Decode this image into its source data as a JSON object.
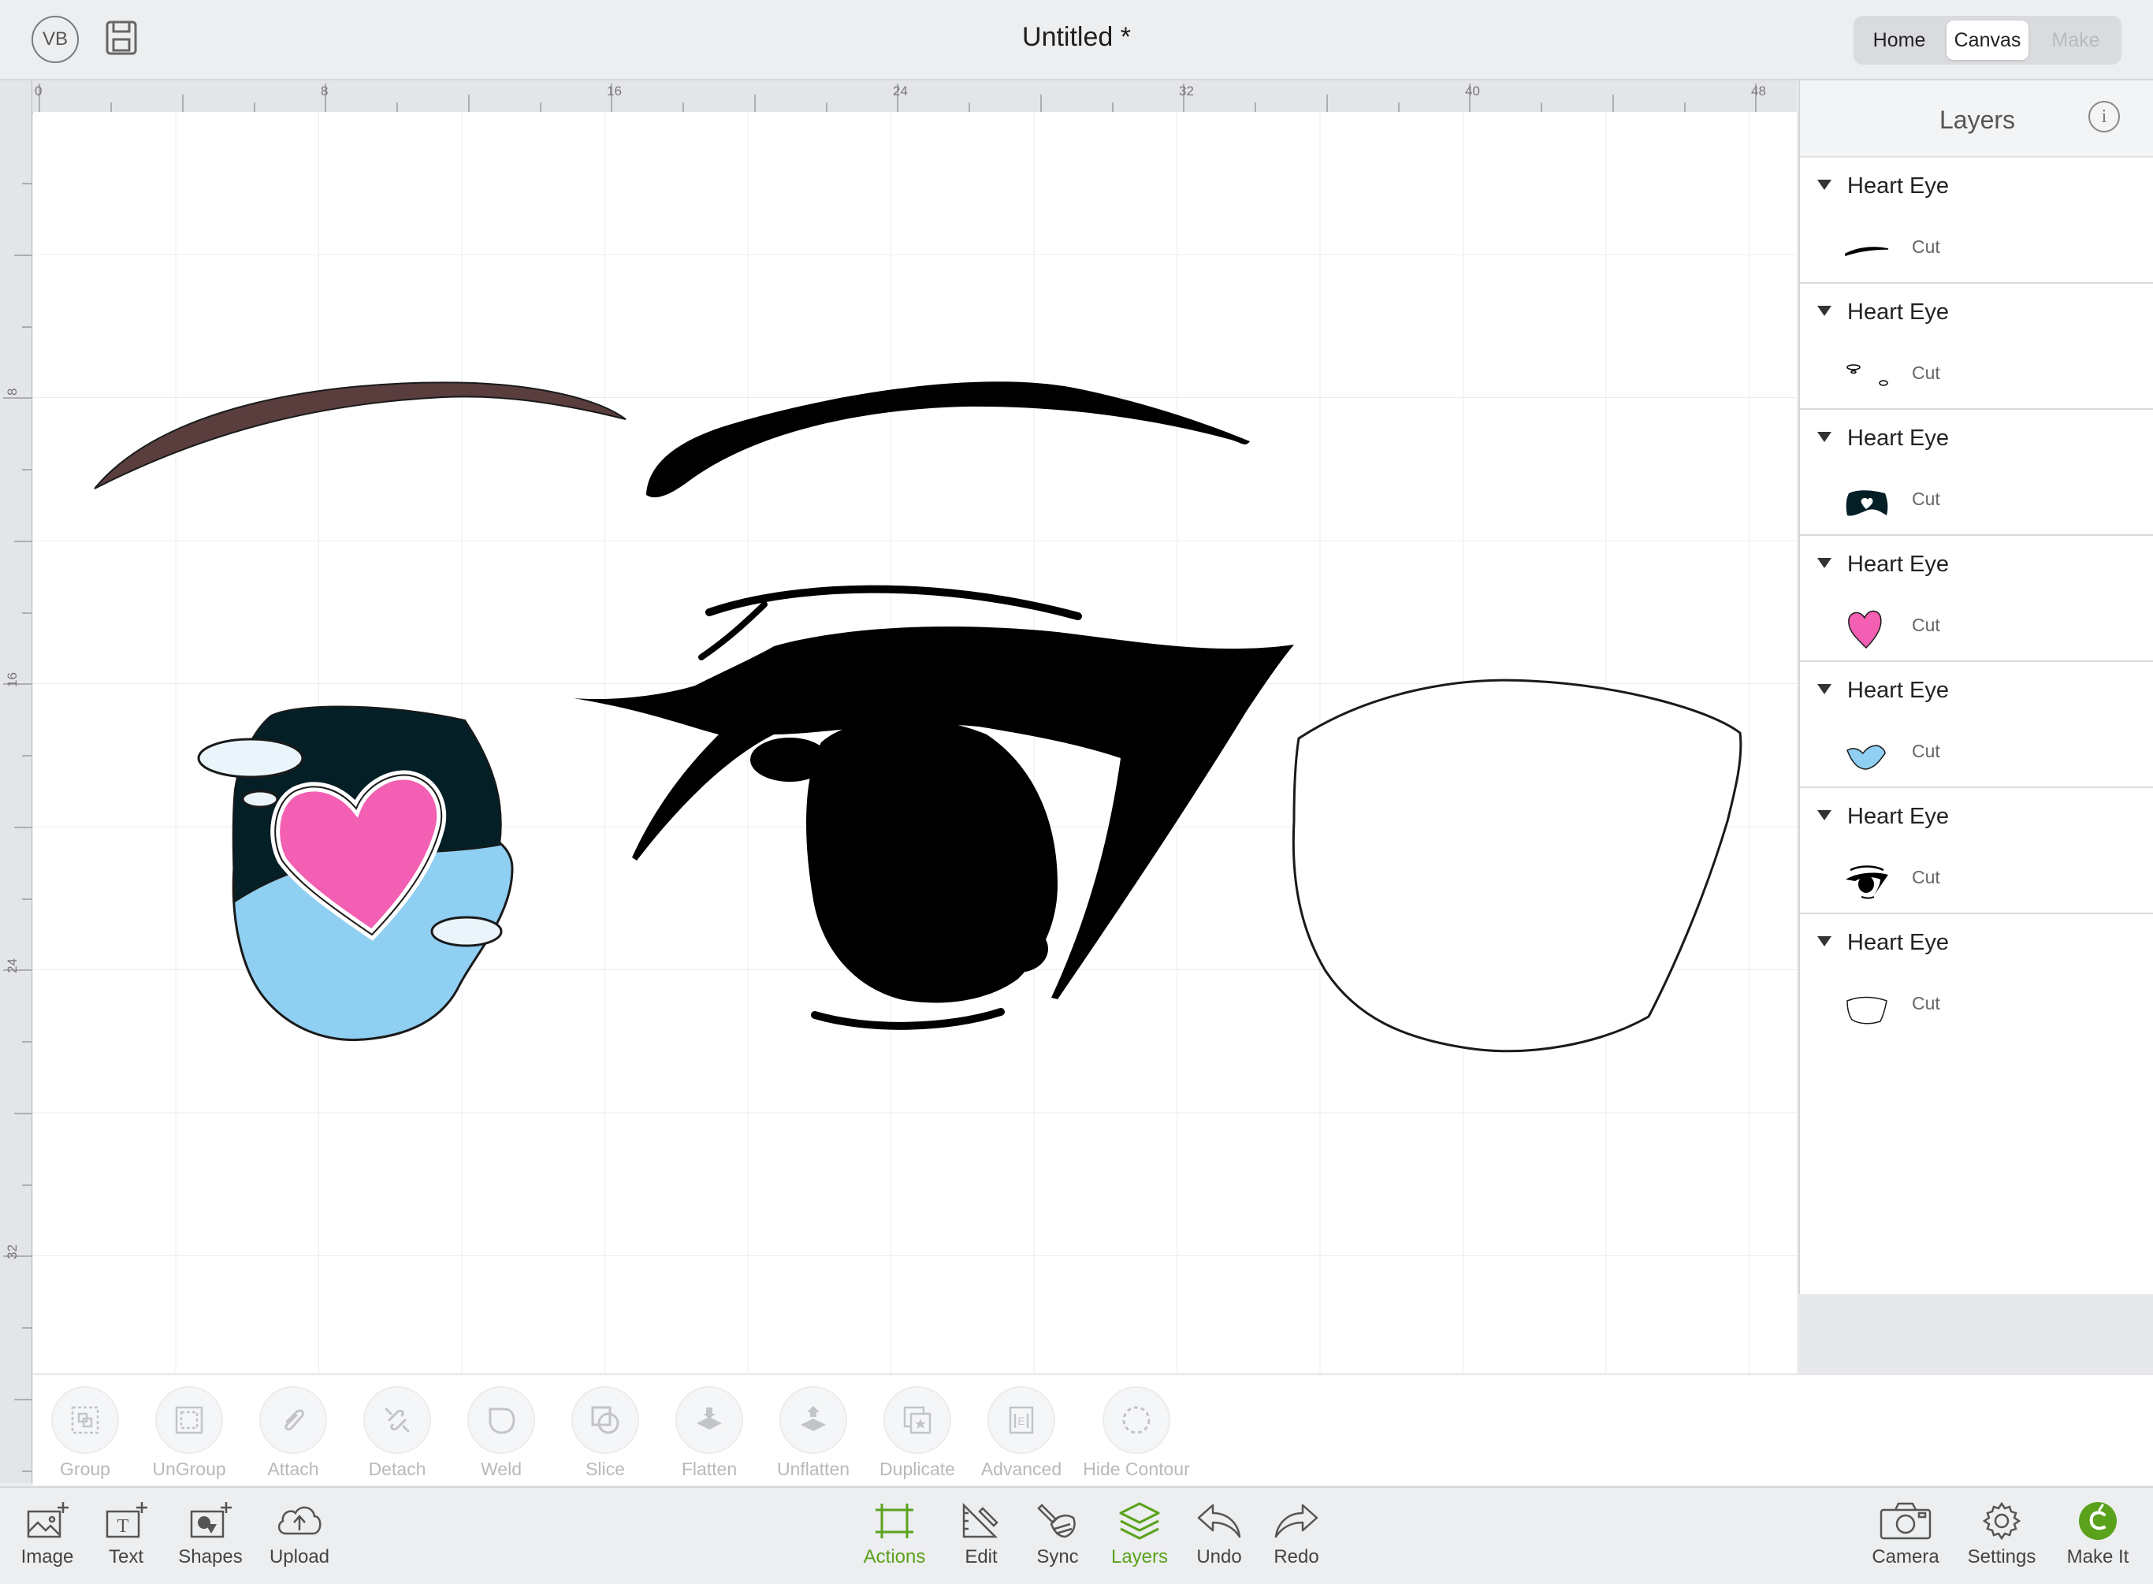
{
  "header": {
    "avatar_initials": "VB",
    "document_title": "Untitled *",
    "modes": {
      "home": "Home",
      "canvas": "Canvas",
      "make": "Make"
    },
    "active_mode": "Canvas"
  },
  "rulers": {
    "horizontal_labels": [
      "0",
      "8",
      "16",
      "24",
      "32",
      "40",
      "48"
    ],
    "vertical_labels": [
      "8",
      "16",
      "24",
      "32"
    ]
  },
  "layers_panel": {
    "title": "Layers",
    "items": [
      {
        "name": "Heart Eye",
        "operation": "Cut",
        "thumbnail": "eyebrow-left-thumb"
      },
      {
        "name": "Heart Eye",
        "operation": "Cut",
        "thumbnail": "highlights-thumb"
      },
      {
        "name": "Heart Eye",
        "operation": "Cut",
        "thumbnail": "iris-dark-thumb"
      },
      {
        "name": "Heart Eye",
        "operation": "Cut",
        "thumbnail": "heart-thumb"
      },
      {
        "name": "Heart Eye",
        "operation": "Cut",
        "thumbnail": "iris-light-thumb"
      },
      {
        "name": "Heart Eye",
        "operation": "Cut",
        "thumbnail": "eye-outline-thumb"
      },
      {
        "name": "Heart Eye",
        "operation": "Cut",
        "thumbnail": "eye-white-thumb"
      }
    ]
  },
  "edit_toolbar": {
    "group": "Group",
    "ungroup": "UnGroup",
    "attach": "Attach",
    "detach": "Detach",
    "weld": "Weld",
    "slice": "Slice",
    "flatten": "Flatten",
    "unflatten": "Unflatten",
    "duplicate": "Duplicate",
    "advanced": "Advanced",
    "hide_contour": "Hide Contour"
  },
  "bottom_nav": {
    "image": "Image",
    "text": "Text",
    "shapes": "Shapes",
    "upload": "Upload",
    "actions": "Actions",
    "edit": "Edit",
    "sync": "Sync",
    "layers": "Layers",
    "undo": "Undo",
    "redo": "Redo",
    "camera": "Camera",
    "settings": "Settings",
    "make_it": "Make It"
  },
  "colors": {
    "accent_green": "#5aa21b",
    "eyebrow_brown": "#5a3e3e",
    "iris_dark": "#041f26",
    "iris_light": "#8fcff2",
    "heart_pink": "#f35fb3"
  }
}
